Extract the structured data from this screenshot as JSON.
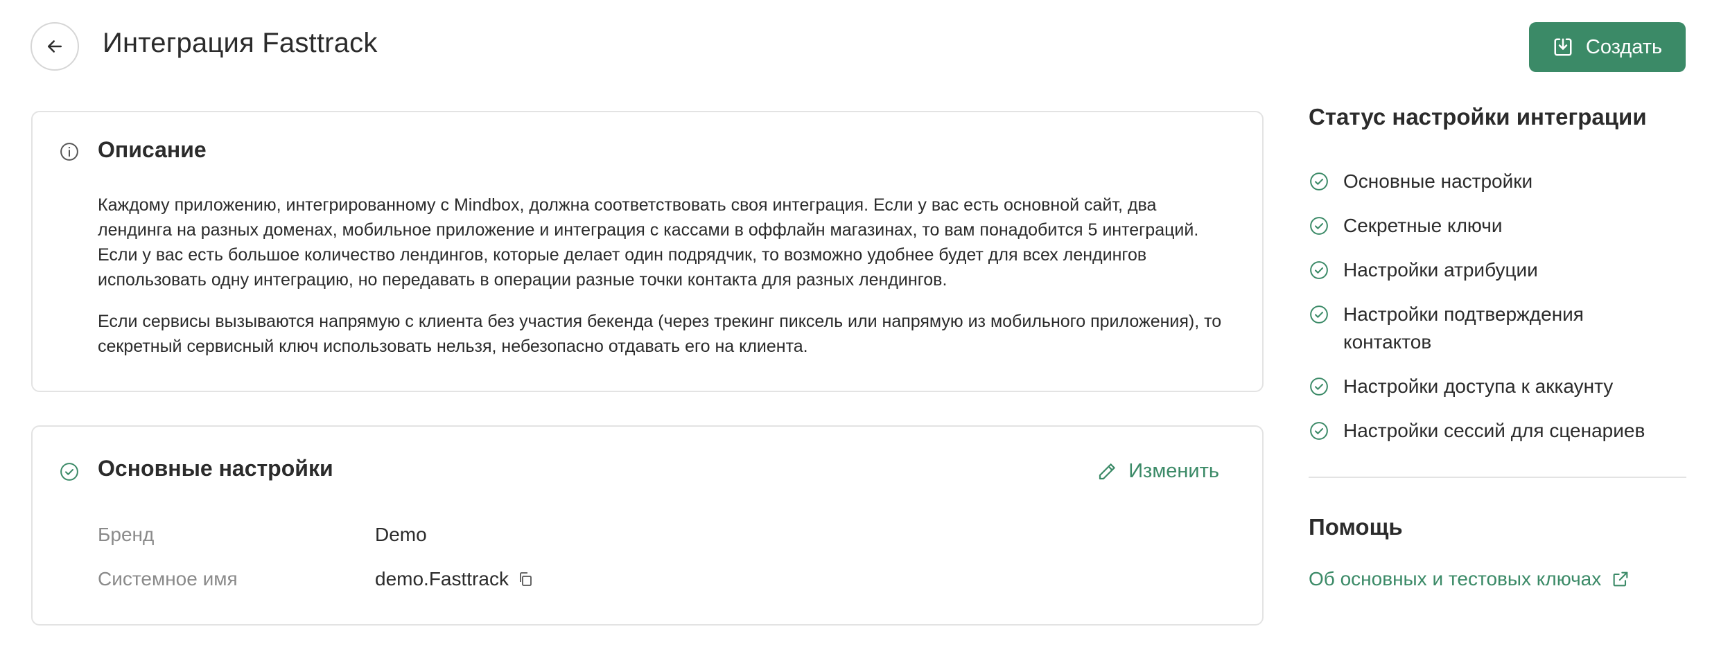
{
  "header": {
    "title": "Интеграция Fasttrack",
    "create_label": "Создать"
  },
  "description": {
    "title": "Описание",
    "paragraphs": [
      "Каждому приложению, интегрированному с Mindbox, должна соответствовать своя интеграция. Если у вас есть основной сайт, два лендинга на разных доменах, мобильное приложение и интеграция с кассами в оффлайн магазинах, то вам понадобится 5 интеграций. Если у вас есть большое количество лендингов, которые делает один подрядчик, то возможно удобнее будет для всех лендингов использовать одну интеграцию, но передавать в операции разные точки контакта для разных лендингов.",
      "Если сервисы вызываются напрямую с клиента без участия бекенда (через трекинг пиксель или напрямую из мобильного приложения), то секретный сервисный ключ использовать нельзя, небезопасно отдавать его на клиента."
    ]
  },
  "main_settings": {
    "title": "Основные настройки",
    "edit_label": "Изменить",
    "fields": [
      {
        "label": "Бренд",
        "value": "Demo"
      },
      {
        "label": "Системное имя",
        "value": "demo.Fasttrack"
      }
    ]
  },
  "sidebar": {
    "status_title": "Статус настройки интеграции",
    "status_items": [
      {
        "label": "Основные настройки"
      },
      {
        "label": "Секретные ключи"
      },
      {
        "label": "Настройки атрибуции"
      },
      {
        "label": "Настройки подтверждения контактов"
      },
      {
        "label": "Настройки доступа к аккаунту"
      },
      {
        "label": "Настройки сессий для сценариев"
      }
    ],
    "help_title": "Помощь",
    "help_link": "Об основных и тестовых ключах"
  },
  "icons": {
    "back": "arrow-left-icon",
    "create": "import-icon",
    "info": "info-icon",
    "check": "check-circle-icon",
    "edit": "pencil-icon",
    "copy": "copy-icon",
    "external": "external-link-icon"
  },
  "colors": {
    "accent": "#3b8a67",
    "text": "#2b2b2b",
    "muted": "#8a8a8a",
    "border": "#e3e3e3"
  }
}
